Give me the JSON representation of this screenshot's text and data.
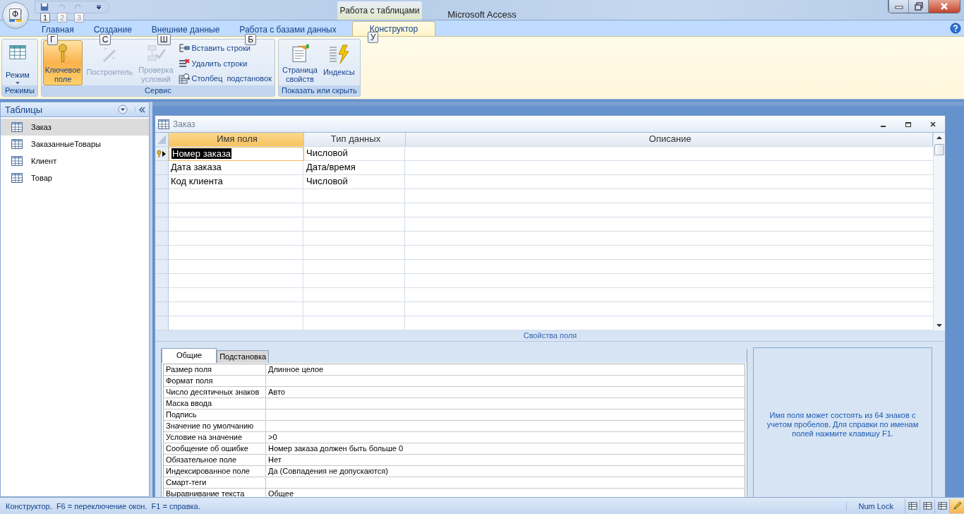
{
  "office_button": {
    "keytip": "Ф"
  },
  "qat": [
    {
      "keytip": "1",
      "disabled": false
    },
    {
      "keytip": "2",
      "disabled": true
    },
    {
      "keytip": "3",
      "disabled": true
    }
  ],
  "contextual_tab": "Работа с таблицами",
  "window": {
    "title": "Microsoft Access"
  },
  "ribbon_tabs": [
    {
      "label": "Главная",
      "keytip": "Г",
      "selected": false
    },
    {
      "label": "Создание",
      "keytip": "С",
      "selected": false
    },
    {
      "label": "Внешние данные",
      "keytip": "Ш",
      "selected": false
    },
    {
      "label": "Работа с базами данных",
      "keytip": "Б",
      "selected": false
    },
    {
      "label": "Конструктор",
      "keytip": "У",
      "selected": true
    }
  ],
  "ribbon_groups": [
    {
      "title": "Режимы",
      "buttons": [
        {
          "label": "Режим",
          "kind": "dropdown",
          "selected": false,
          "disabled": false
        }
      ]
    },
    {
      "title": "Сервис",
      "buttons": [
        {
          "label": "Ключевое поле",
          "kind": "large",
          "selected": true,
          "disabled": false
        },
        {
          "label": "Построитель",
          "kind": "large",
          "selected": false,
          "disabled": true
        },
        {
          "label": "Проверка условий",
          "kind": "large",
          "selected": false,
          "disabled": true
        },
        {
          "label": "Вставить строки",
          "kind": "small",
          "selected": false,
          "disabled": false
        },
        {
          "label": "Удалить строки",
          "kind": "small",
          "selected": false,
          "disabled": false
        },
        {
          "label": "Столбец  подстановок",
          "kind": "small",
          "selected": false,
          "disabled": false
        }
      ]
    },
    {
      "title": "Показать или скрыть",
      "buttons": [
        {
          "label": "Страница свойств",
          "kind": "large",
          "selected": false,
          "disabled": false
        },
        {
          "label": "Индексы",
          "kind": "large",
          "selected": false,
          "disabled": false
        }
      ]
    }
  ],
  "nav_pane": {
    "title": "Таблицы",
    "items": [
      {
        "label": "Заказ",
        "selected": true
      },
      {
        "label": "ЗаказанныеТовары",
        "selected": false
      },
      {
        "label": "Клиент",
        "selected": false
      },
      {
        "label": "Товар",
        "selected": false
      }
    ]
  },
  "document": {
    "title": "Заказ",
    "columns": [
      "Имя поля",
      "Тип данных",
      "Описание"
    ],
    "rows": [
      {
        "name": "Номер заказа",
        "type": "Числовой",
        "key": true,
        "current": true
      },
      {
        "name": "Дата заказа",
        "type": "Дата/время",
        "key": false,
        "current": false
      },
      {
        "name": "Код клиента",
        "type": "Числовой",
        "key": false,
        "current": false
      }
    ],
    "properties_title": "Свойства поля",
    "property_tabs": [
      {
        "label": "Общие",
        "selected": true
      },
      {
        "label": "Подстановка",
        "selected": false
      }
    ],
    "properties": [
      {
        "name": "Размер поля",
        "value": "Длинное целое"
      },
      {
        "name": "Формат поля"
      },
      {
        "name": "Число десятичных знаков",
        "value": "Авто"
      },
      {
        "name": "Маска ввода"
      },
      {
        "name": "Подпись"
      },
      {
        "name": "Значение по умолчанию"
      },
      {
        "name": "Условие на значение",
        "value": ">0"
      },
      {
        "name": "Сообщение об ошибке",
        "value": "Номер заказа должен быть больше 0"
      },
      {
        "name": "Обязательное поле",
        "value": "Нет"
      },
      {
        "name": "Индексированное поле",
        "value": "Да (Совпадения не допускаются)"
      },
      {
        "name": "Смарт-теги"
      },
      {
        "name": "Выравнивание текста",
        "value": "Общее"
      }
    ],
    "help_text": "Имя поля может состоять из 64 знаков с учетом пробелов.  Для справки по именам полей нажмите клавишу F1."
  },
  "status_bar": {
    "text": "Конструктор.  F6 = переключение окон.  F1 = справка.",
    "indicator": "Num Lock",
    "views": [
      {
        "selected": false
      },
      {
        "selected": false
      },
      {
        "selected": false
      },
      {
        "selected": true
      }
    ]
  }
}
